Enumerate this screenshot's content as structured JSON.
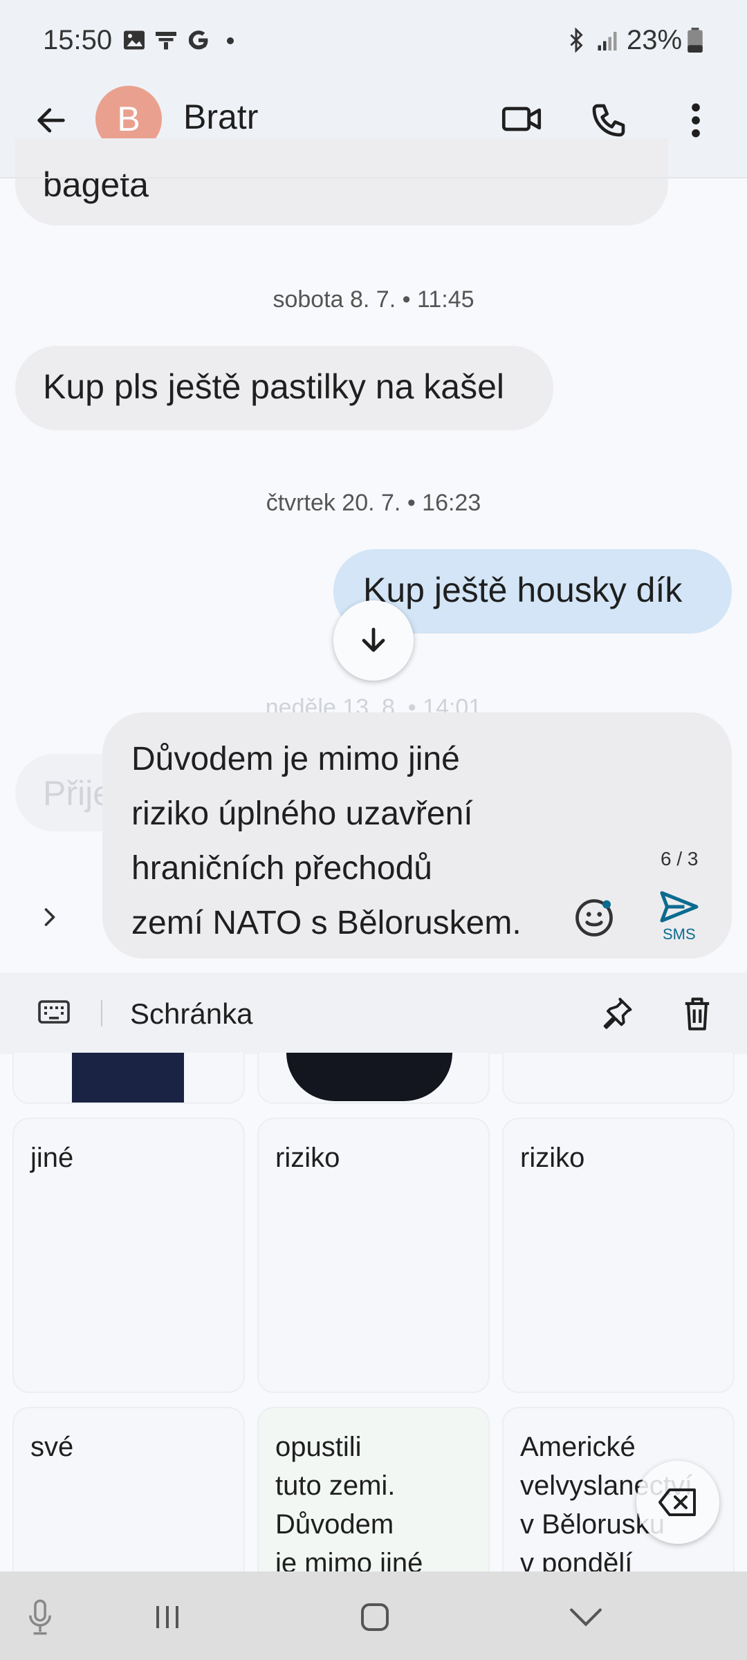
{
  "status_bar": {
    "time": "15:50",
    "battery": "23%"
  },
  "header": {
    "avatar_letter": "B",
    "contact_name": "Bratr"
  },
  "conversation": {
    "partial_message": "bageta",
    "timestamp_1": "sobota 8. 7. • 11:45",
    "message_1": "Kup pls ještě pastilky na kašel",
    "timestamp_2": "čtvrtek 20. 7. • 16:23",
    "message_2": "Kup ještě housky dík",
    "timestamp_3": "neděle 13. 8. • 14:01",
    "partial_incoming": "Přije"
  },
  "compose": {
    "line_1": "Důvodem je mimo jiné",
    "line_2": "riziko úplného uzavření",
    "line_3": "hraničních přechodů",
    "line_4": "zemí NATO s Běloruskem.",
    "counter": "6 / 3",
    "send_label": "SMS"
  },
  "clipboard": {
    "title": "Schránka",
    "cards_row1": [
      "jiné",
      "riziko",
      "riziko"
    ],
    "card_sve": "své",
    "card_opustili": [
      "opustili",
      "tuto zemi.",
      "Důvodem",
      "je mimo jiné"
    ],
    "card_americke": [
      "Americké",
      "velvyslanectví",
      "v Bělorusku",
      "v pondělí"
    ]
  },
  "colors": {
    "accent": "#0b6b8e",
    "avatar": "#eaa08f",
    "outgoing_bubble": "#d3e5f6"
  }
}
